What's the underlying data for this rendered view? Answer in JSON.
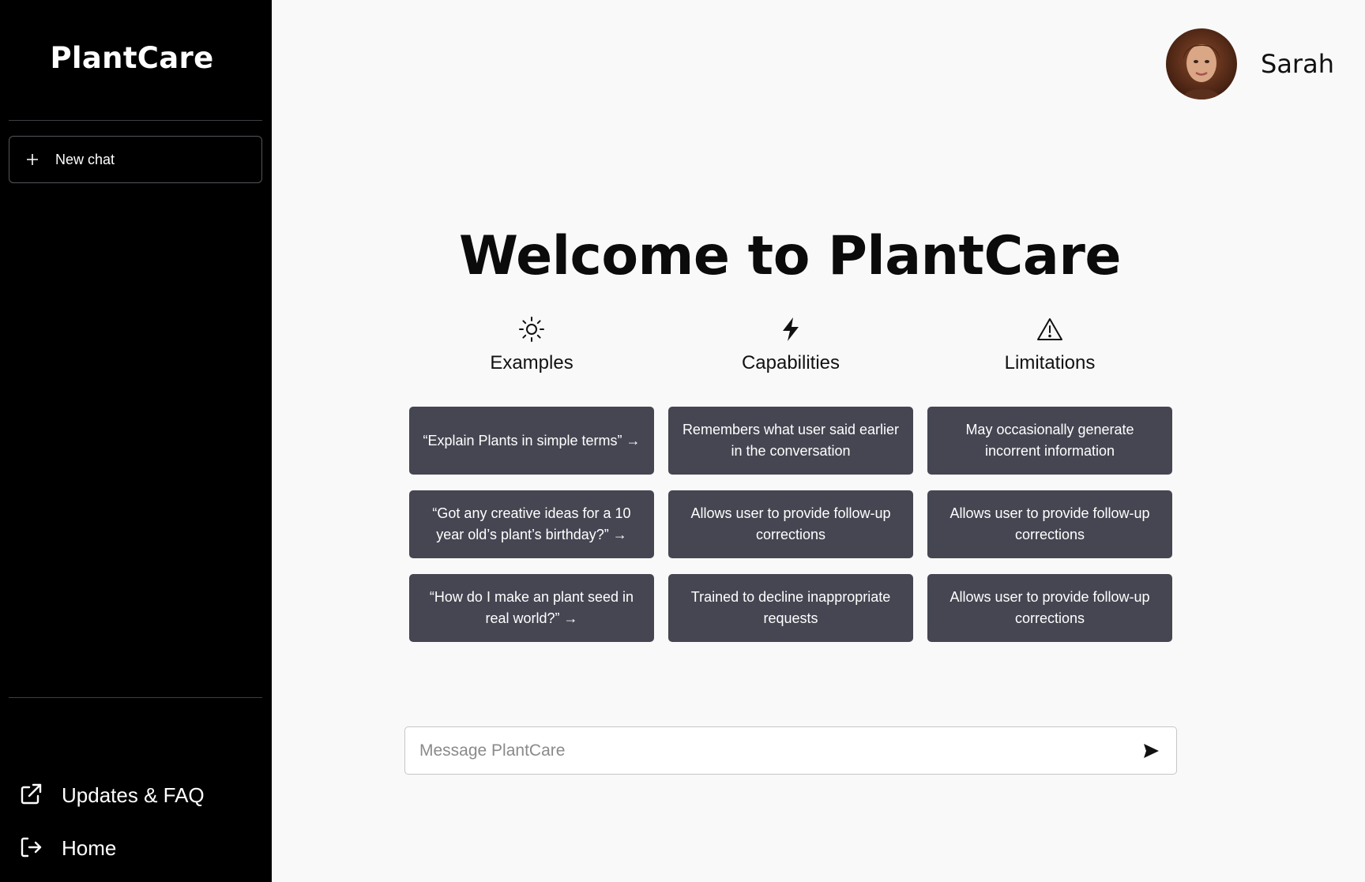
{
  "sidebar": {
    "brand": "PlantCare",
    "new_chat_label": "New chat",
    "nav": [
      {
        "label": "Updates & FAQ",
        "icon": "external-link-icon"
      },
      {
        "label": "Home",
        "icon": "logout-icon"
      }
    ]
  },
  "header": {
    "user_name": "Sarah"
  },
  "main": {
    "title": "Welcome to PlantCare",
    "columns": [
      {
        "heading": "Examples",
        "icon": "sun-icon",
        "cards": [
          "“Explain Plants in simple terms” →",
          "“Got any creative ideas for a 10 year old’s plant’s birthday?” →",
          "“How do I make an plant seed in real world?” →"
        ]
      },
      {
        "heading": "Capabilities",
        "icon": "lightning-icon",
        "cards": [
          "Remembers what user said earlier in the conversation",
          "Allows user to provide follow-up corrections",
          "Trained to decline inappropriate requests"
        ]
      },
      {
        "heading": "Limitations",
        "icon": "warning-icon",
        "cards": [
          "May occasionally generate incorrent information",
          "Allows user to provide follow-up corrections",
          "Allows user to provide follow-up corrections"
        ]
      }
    ]
  },
  "composer": {
    "placeholder": "Message PlantCare",
    "value": ""
  },
  "colors": {
    "sidebar_bg": "#000000",
    "main_bg": "#f9f9f9",
    "card_bg": "#454652"
  }
}
